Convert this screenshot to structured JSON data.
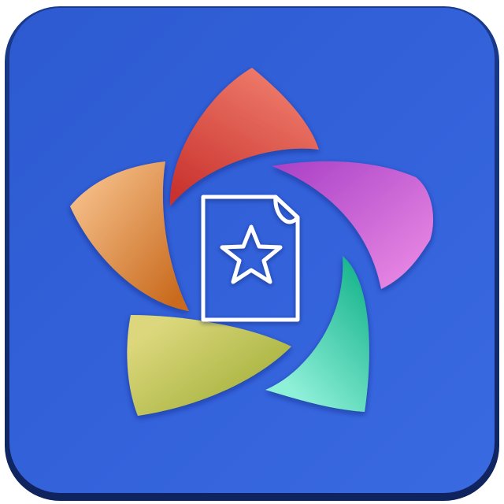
{
  "icon": {
    "subject": "document-star-icon",
    "colors": {
      "tile_top": "#2f5fd3",
      "tile_bottom": "#3565df",
      "tile_edge": "#16307a",
      "petal_red": "#e9574a",
      "petal_magenta": "#d25ad8",
      "petal_teal": "#3fd6b0",
      "petal_lime": "#c6cd5a",
      "petal_orange": "#e89a4a",
      "glyph_stroke": "#ffffff"
    }
  }
}
